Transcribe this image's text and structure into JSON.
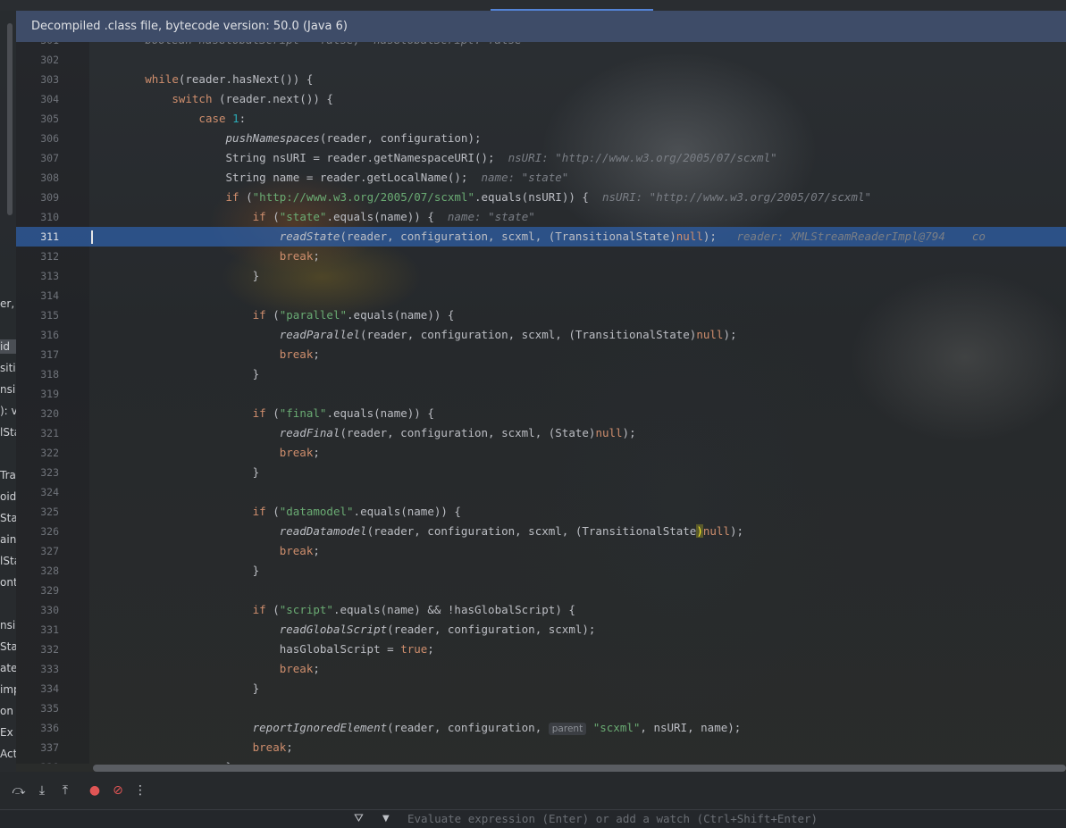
{
  "banner": {
    "text": "Decompiled .class file, bytecode version: 50.0 (Java 6)"
  },
  "left_panel_fragments": [
    "er,",
    "id",
    "siti",
    "nsi",
    "): v",
    "lSta",
    "Tra",
    "oid",
    "Stat",
    "ainer",
    "lSta",
    "onta",
    "nsi",
    "Stat",
    "ate",
    "imp",
    "on",
    "Ex",
    "Acti"
  ],
  "code_lines": [
    {
      "n": "301",
      "segments": [
        {
          "t": "        boolean hasGlobalScript = false;  hasGlobalScript: false",
          "c": "hint"
        }
      ]
    },
    {
      "n": "302",
      "segments": []
    },
    {
      "n": "303",
      "segments": [
        {
          "t": "        ",
          "c": ""
        },
        {
          "t": "while",
          "c": "kw"
        },
        {
          "t": "(reader.hasNext()) {",
          "c": ""
        }
      ]
    },
    {
      "n": "304",
      "segments": [
        {
          "t": "            ",
          "c": ""
        },
        {
          "t": "switch",
          "c": "kw"
        },
        {
          "t": " (reader.next()) {",
          "c": ""
        }
      ]
    },
    {
      "n": "305",
      "segments": [
        {
          "t": "                ",
          "c": ""
        },
        {
          "t": "case",
          "c": "kw"
        },
        {
          "t": " ",
          "c": ""
        },
        {
          "t": "1",
          "c": "num"
        },
        {
          "t": ":",
          "c": ""
        }
      ]
    },
    {
      "n": "306",
      "segments": [
        {
          "t": "                    ",
          "c": ""
        },
        {
          "t": "pushNamespaces",
          "c": "fn"
        },
        {
          "t": "(reader, configuration);",
          "c": ""
        }
      ]
    },
    {
      "n": "307",
      "segments": [
        {
          "t": "                    String nsURI = reader.getNamespaceURI();",
          "c": ""
        },
        {
          "t": "  nsURI: \"http://www.w3.org/2005/07/scxml\"",
          "c": "hint"
        }
      ]
    },
    {
      "n": "308",
      "segments": [
        {
          "t": "                    String name = reader.getLocalName();",
          "c": ""
        },
        {
          "t": "  name: \"state\"",
          "c": "hint"
        }
      ]
    },
    {
      "n": "309",
      "segments": [
        {
          "t": "                    ",
          "c": ""
        },
        {
          "t": "if",
          "c": "kw"
        },
        {
          "t": " (",
          "c": ""
        },
        {
          "t": "\"http://www.w3.org/2005/07/scxml\"",
          "c": "str"
        },
        {
          "t": ".equals(nsURI)) {",
          "c": ""
        },
        {
          "t": "  nsURI: \"http://www.w3.org/2005/07/scxml\"",
          "c": "hint"
        }
      ]
    },
    {
      "n": "310",
      "segments": [
        {
          "t": "                        ",
          "c": ""
        },
        {
          "t": "if",
          "c": "kw"
        },
        {
          "t": " (",
          "c": ""
        },
        {
          "t": "\"state\"",
          "c": "str"
        },
        {
          "t": ".equals(name)) {",
          "c": ""
        },
        {
          "t": "  name: \"state\"",
          "c": "hint"
        }
      ]
    },
    {
      "n": "311",
      "current": true,
      "segments": [
        {
          "t": "                            ",
          "c": ""
        },
        {
          "t": "readState",
          "c": "fn"
        },
        {
          "t": "(reader, configuration, scxml, (TransitionalState)",
          "c": ""
        },
        {
          "t": "null",
          "c": "kw"
        },
        {
          "t": ");",
          "c": ""
        },
        {
          "t": "   reader: XMLStreamReaderImpl@794    co",
          "c": "hint"
        }
      ]
    },
    {
      "n": "312",
      "segments": [
        {
          "t": "                            ",
          "c": ""
        },
        {
          "t": "break",
          "c": "kw"
        },
        {
          "t": ";",
          "c": ""
        }
      ]
    },
    {
      "n": "313",
      "segments": [
        {
          "t": "                        }",
          "c": ""
        }
      ]
    },
    {
      "n": "314",
      "segments": []
    },
    {
      "n": "315",
      "segments": [
        {
          "t": "                        ",
          "c": ""
        },
        {
          "t": "if",
          "c": "kw"
        },
        {
          "t": " (",
          "c": ""
        },
        {
          "t": "\"parallel\"",
          "c": "str"
        },
        {
          "t": ".equals(name)) {",
          "c": ""
        }
      ]
    },
    {
      "n": "316",
      "segments": [
        {
          "t": "                            ",
          "c": ""
        },
        {
          "t": "readParallel",
          "c": "fn"
        },
        {
          "t": "(reader, configuration, scxml, (TransitionalState)",
          "c": ""
        },
        {
          "t": "null",
          "c": "kw"
        },
        {
          "t": ");",
          "c": ""
        }
      ]
    },
    {
      "n": "317",
      "segments": [
        {
          "t": "                            ",
          "c": ""
        },
        {
          "t": "break",
          "c": "kw"
        },
        {
          "t": ";",
          "c": ""
        }
      ]
    },
    {
      "n": "318",
      "segments": [
        {
          "t": "                        }",
          "c": ""
        }
      ]
    },
    {
      "n": "319",
      "segments": []
    },
    {
      "n": "320",
      "segments": [
        {
          "t": "                        ",
          "c": ""
        },
        {
          "t": "if",
          "c": "kw"
        },
        {
          "t": " (",
          "c": ""
        },
        {
          "t": "\"final\"",
          "c": "str"
        },
        {
          "t": ".equals(name)) {",
          "c": ""
        }
      ]
    },
    {
      "n": "321",
      "segments": [
        {
          "t": "                            ",
          "c": ""
        },
        {
          "t": "readFinal",
          "c": "fn"
        },
        {
          "t": "(reader, configuration, scxml, (State)",
          "c": ""
        },
        {
          "t": "null",
          "c": "kw"
        },
        {
          "t": ");",
          "c": ""
        }
      ]
    },
    {
      "n": "322",
      "segments": [
        {
          "t": "                            ",
          "c": ""
        },
        {
          "t": "break",
          "c": "kw"
        },
        {
          "t": ";",
          "c": ""
        }
      ]
    },
    {
      "n": "323",
      "segments": [
        {
          "t": "                        }",
          "c": ""
        }
      ]
    },
    {
      "n": "324",
      "segments": []
    },
    {
      "n": "325",
      "segments": [
        {
          "t": "                        ",
          "c": ""
        },
        {
          "t": "if",
          "c": "kw"
        },
        {
          "t": " (",
          "c": ""
        },
        {
          "t": "\"datamodel\"",
          "c": "str"
        },
        {
          "t": ".equals(name)) {",
          "c": ""
        }
      ]
    },
    {
      "n": "326",
      "segments": [
        {
          "t": "                            ",
          "c": ""
        },
        {
          "t": "readDatamodel",
          "c": "fn"
        },
        {
          "t": "(reader, configuration, scxml, (TransitionalState",
          "c": ""
        },
        {
          "t": ")",
          "c": "paren-hl"
        },
        {
          "t": "null",
          "c": "kw"
        },
        {
          "t": ");",
          "c": ""
        }
      ]
    },
    {
      "n": "327",
      "segments": [
        {
          "t": "                            ",
          "c": ""
        },
        {
          "t": "break",
          "c": "kw"
        },
        {
          "t": ";",
          "c": ""
        }
      ]
    },
    {
      "n": "328",
      "segments": [
        {
          "t": "                        }",
          "c": ""
        }
      ]
    },
    {
      "n": "329",
      "segments": []
    },
    {
      "n": "330",
      "segments": [
        {
          "t": "                        ",
          "c": ""
        },
        {
          "t": "if",
          "c": "kw"
        },
        {
          "t": " (",
          "c": ""
        },
        {
          "t": "\"script\"",
          "c": "str"
        },
        {
          "t": ".equals(name) && !hasGlobalScript) {",
          "c": ""
        }
      ]
    },
    {
      "n": "331",
      "segments": [
        {
          "t": "                            ",
          "c": ""
        },
        {
          "t": "readGlobalScript",
          "c": "fn"
        },
        {
          "t": "(reader, configuration, scxml);",
          "c": ""
        }
      ]
    },
    {
      "n": "332",
      "segments": [
        {
          "t": "                            hasGlobalScript = ",
          "c": ""
        },
        {
          "t": "true",
          "c": "kw"
        },
        {
          "t": ";",
          "c": ""
        }
      ]
    },
    {
      "n": "333",
      "segments": [
        {
          "t": "                            ",
          "c": ""
        },
        {
          "t": "break",
          "c": "kw"
        },
        {
          "t": ";",
          "c": ""
        }
      ]
    },
    {
      "n": "334",
      "segments": [
        {
          "t": "                        }",
          "c": ""
        }
      ]
    },
    {
      "n": "335",
      "segments": []
    },
    {
      "n": "336",
      "segments": [
        {
          "t": "                        ",
          "c": ""
        },
        {
          "t": "reportIgnoredElement",
          "c": "fn"
        },
        {
          "t": "(reader, configuration, ",
          "c": ""
        },
        {
          "t": "parent",
          "c": "hint-box"
        },
        {
          "t": " ",
          "c": ""
        },
        {
          "t": "\"scxml\"",
          "c": "str"
        },
        {
          "t": ", nsURI, name);",
          "c": ""
        }
      ]
    },
    {
      "n": "337",
      "segments": [
        {
          "t": "                        ",
          "c": ""
        },
        {
          "t": "break",
          "c": "kw"
        },
        {
          "t": ";",
          "c": ""
        }
      ]
    },
    {
      "n": "338",
      "segments": [
        {
          "t": "                    }",
          "c": ""
        }
      ]
    }
  ],
  "toolbar": {
    "icons": [
      "step-over-icon",
      "step-into-icon",
      "step-out-icon",
      "breakpoint-icon",
      "mute-breakpoints-icon",
      "more-icon"
    ]
  },
  "eval": {
    "placeholder": "Evaluate expression (Enter) or add a watch (Ctrl+Shift+Enter)"
  }
}
